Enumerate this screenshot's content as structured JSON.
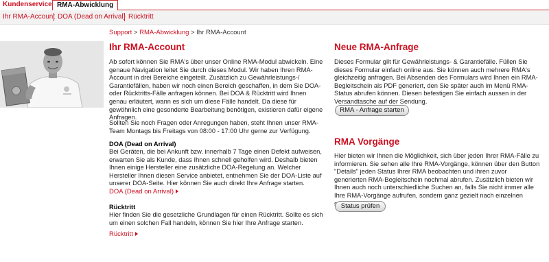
{
  "tabs": [
    {
      "label": "Kundenservice"
    },
    {
      "label": "RMA-Abwicklung"
    }
  ],
  "subnav": [
    {
      "label": "Ihr RMA-Account"
    },
    {
      "label": "DOA (Dead on Arrival)"
    },
    {
      "label": "Rücktritt"
    }
  ],
  "breadcrumb": {
    "support": "Support",
    "sep1": " > ",
    "rma": "RMA-Abwicklung",
    "sep2": " > ",
    "current": "Ihr RMA-Account"
  },
  "left": {
    "title": "Ihr RMA-Account",
    "intro": "Ab sofort können Sie RMA's über unser Online RMA-Modul abwickeln. Eine genaue Navigation leitet Sie durch dieses Modul. Wir haben Ihren RMA-Account in drei Bereiche eingeteilt. Zusätzlich zu Gewährleistungs-/ Garantiefällen, haben wir noch einen Bereich geschaffen, in dem Sie DOA- oder Rücktritts-Fälle anfragen können. Bei DOA & Rücktritt wird Ihnen genau erläutert, wann es sich um diese Fälle handelt. Da diese für gewöhnlich eine gesonderte Bearbeitung benötigen, existieren dafür eigene Anfragen.",
    "contact": "Sollten Sie noch Fragen oder Anregungen haben, steht Ihnen unser RMA-Team Montags bis Freitags von 08:00 - 17:00 Uhr gerne zur Verfügung.",
    "doa_title": "DOA (Dead on Arrival)",
    "doa_text": "Bei Geräten, die bei Ankunft bzw. innerhalb 7 Tage einen Defekt aufweisen, erwarten Sie als Kunde, dass Ihnen schnell geholfen wird. Deshalb bieten Ihnen einige Hersteller eine zusätzliche DOA-Regelung an. Welcher Hersteller Ihnen diesen Service anbietet, entnehmen Sie der DOA-Liste auf unserer DOA-Seite. Hier können Sie auch direkt Ihre Anfrage starten.",
    "doa_link": "DOA (Dead on Arrival)",
    "ruecktritt_title": "Rücktritt",
    "ruecktritt_text": "Hier finden Sie die gesetzliche Grundlagen für einen Rücktritt. Sollte es sich um einen solchen Fall handeln, können Sie hier Ihre Anfrage starten.",
    "ruecktritt_link": "Rücktritt"
  },
  "right": {
    "new_title": "Neue RMA-Anfrage",
    "new_text": "Dieses Formular gilt für Gewährleistungs- & Garantiefälle. Füllen Sie dieses Formular einfach online aus. Sie können auch mehrere RMA's gleichzeitig anfragen. Bei Absenden des Formulars wird Ihnen ein RMA-Begleitschein als PDF generiert, den Sie später auch im Menü RMA-Status abrufen können. Diesen befestigen Sie einfach aussen in der Versandtasche auf der Sendung.",
    "new_button": "RMA - Anfrage starten",
    "proc_title": "RMA Vorgänge",
    "proc_text": "Hier bieten wir Ihnen die Möglichkeit, sich über jeden Ihrer RMA-Fälle zu informieren. Sie sehen alle Ihre RMA-Vorgänge, können über den Button \"Details\" jeden Status Ihrer RMA beobachten und ihren zuvor generierten RMA-Begleitschein nochmal abrufen. Zusätzlich bieten wir Ihnen auch noch unterschiedliche Suchen an, falls Sie nicht immer alle Ihre RMA-Vorgänge aufrufen, sondern ganz gezielt nach einzelnen suchen möchten.",
    "proc_button": "Status prüfen"
  },
  "colors": {
    "accent": "#cc1122"
  }
}
